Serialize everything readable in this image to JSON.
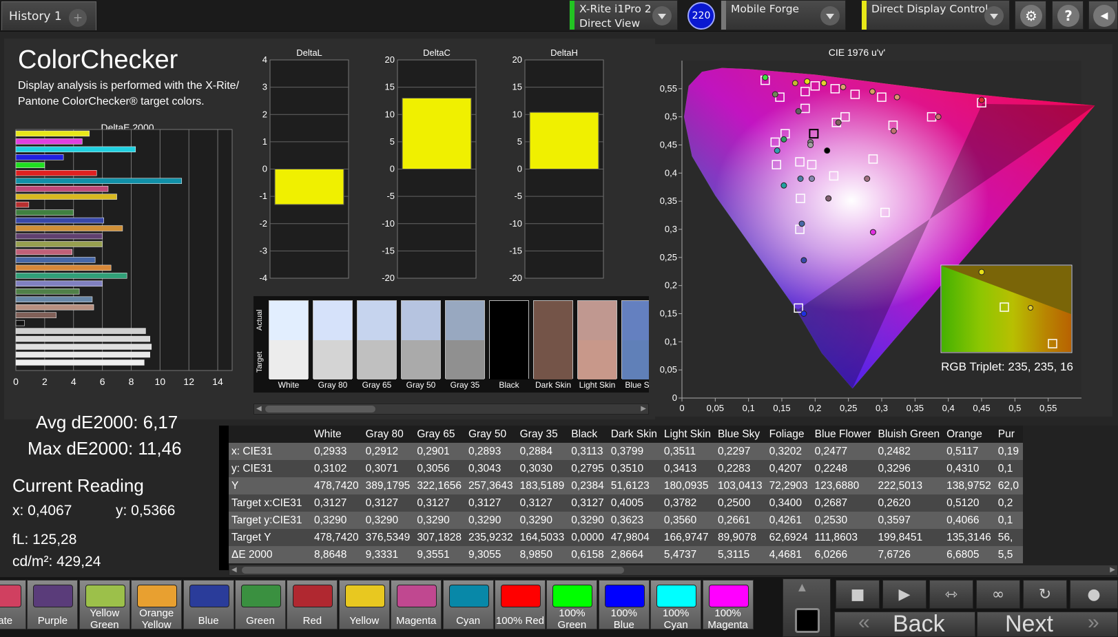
{
  "topbar": {
    "history_tab": "History 1",
    "add_tab": "+",
    "meter_line1": "X-Rite i1Pro 2",
    "meter_line2": "Direct View",
    "badge": "220",
    "generator": "Mobile Forge",
    "display": "Direct Display Control",
    "settings_glyph": "⚙",
    "help_glyph": "?",
    "colors": {
      "meter": "#22c422",
      "generator": "#777777",
      "display": "#e8e818",
      "badge": "#0a18d0"
    }
  },
  "header": {
    "title": "ColorChecker",
    "description": "Display analysis is performed with the X-Rite/ Pantone ColorChecker® target colors."
  },
  "de_chart": {
    "title": "DeltaE 2000",
    "ticks": [
      "0",
      "2",
      "4",
      "6",
      "8",
      "10",
      "12",
      "14"
    ],
    "xlim": [
      0,
      15
    ],
    "bars": [
      {
        "v": 5.1,
        "c": "#e8e818"
      },
      {
        "v": 4.6,
        "c": "#e040e0"
      },
      {
        "v": 8.3,
        "c": "#20d0e0"
      },
      {
        "v": 3.3,
        "c": "#2020e0"
      },
      {
        "v": 2.0,
        "c": "#20e020"
      },
      {
        "v": 5.6,
        "c": "#e02020"
      },
      {
        "v": 11.5,
        "c": "#1090a8"
      },
      {
        "v": 6.4,
        "c": "#c04878"
      },
      {
        "v": 7.0,
        "c": "#d8b820"
      },
      {
        "v": 0.9,
        "c": "#b83030"
      },
      {
        "v": 4.0,
        "c": "#408040"
      },
      {
        "v": 6.1,
        "c": "#3848a8"
      },
      {
        "v": 7.4,
        "c": "#d09038"
      },
      {
        "v": 6.0,
        "c": "#604070"
      },
      {
        "v": 6.0,
        "c": "#98a050"
      },
      {
        "v": 3.9,
        "c": "#c06078"
      },
      {
        "v": 5.5,
        "c": "#4868a8"
      },
      {
        "v": 6.6,
        "c": "#d88838"
      },
      {
        "v": 7.7,
        "c": "#30a078"
      },
      {
        "v": 6.0,
        "c": "#8080c0"
      },
      {
        "v": 4.4,
        "c": "#508048"
      },
      {
        "v": 5.3,
        "c": "#6888a8"
      },
      {
        "v": 5.4,
        "c": "#b89080"
      },
      {
        "v": 2.8,
        "c": "#806058"
      },
      {
        "v": 0.6,
        "c": "#111111"
      },
      {
        "v": 9.0,
        "c": "#d0d0d0"
      },
      {
        "v": 9.3,
        "c": "#d8d8d8"
      },
      {
        "v": 9.4,
        "c": "#e0e0e0"
      },
      {
        "v": 9.3,
        "c": "#e8e8e8"
      },
      {
        "v": 8.9,
        "c": "#f0f0f0"
      }
    ]
  },
  "small_charts": [
    {
      "title": "DeltaL",
      "ticks": [
        "4",
        "3",
        "2",
        "1",
        "0",
        "-1",
        "-2",
        "-3",
        "-4"
      ],
      "ylim": [
        -4,
        4
      ],
      "value": -1.3
    },
    {
      "title": "DeltaC",
      "ticks": [
        "20",
        "15",
        "10",
        "5",
        "0",
        "-5",
        "-10",
        "-15",
        "-20"
      ],
      "ylim": [
        -20,
        20
      ],
      "value": 13.0
    },
    {
      "title": "DeltaH",
      "ticks": [
        "20",
        "15",
        "10",
        "5",
        "0",
        "-5",
        "-10",
        "-15",
        "-20"
      ],
      "ylim": [
        -20,
        20
      ],
      "value": 10.4
    }
  ],
  "swatches": {
    "actual_label": "Actual",
    "target_label": "Target",
    "items": [
      {
        "name": "White",
        "actual": "#e2eefe",
        "target": "#ececec"
      },
      {
        "name": "Gray 80",
        "actual": "#d6e2fa",
        "target": "#d4d4d4"
      },
      {
        "name": "Gray 65",
        "actual": "#c6d4ee",
        "target": "#c0c0c0"
      },
      {
        "name": "Gray 50",
        "actual": "#b6c4e0",
        "target": "#aaaaaa"
      },
      {
        "name": "Gray 35",
        "actual": "#98a8c0",
        "target": "#909090"
      },
      {
        "name": "Black",
        "actual": "#000000",
        "target": "#000000"
      },
      {
        "name": "Dark Skin",
        "actual": "#745448",
        "target": "#745448"
      },
      {
        "name": "Light Skin",
        "actual": "#c09890",
        "target": "#c8988a"
      },
      {
        "name": "Blue Sky",
        "actual": "#6480c0",
        "target": "#6080b8"
      }
    ]
  },
  "cie": {
    "title": "CIE 1976 u'v'",
    "xticks": [
      "0",
      "0,05",
      "0,1",
      "0,15",
      "0,2",
      "0,25",
      "0,3",
      "0,35",
      "0,4",
      "0,45",
      "0,5",
      "0,55"
    ],
    "yticks": [
      "0",
      "0,05",
      "0,1",
      "0,15",
      "0,2",
      "0,25",
      "0,3",
      "0,35",
      "0,4",
      "0,45",
      "0,5",
      "0,55"
    ],
    "xlim": [
      0,
      0.6
    ],
    "ylim": [
      0,
      0.6
    ],
    "targets": [
      [
        0.125,
        0.565
      ],
      [
        0.147,
        0.535
      ],
      [
        0.185,
        0.545
      ],
      [
        0.2,
        0.555
      ],
      [
        0.23,
        0.55
      ],
      [
        0.26,
        0.54
      ],
      [
        0.3,
        0.535
      ],
      [
        0.45,
        0.525
      ],
      [
        0.185,
        0.515
      ],
      [
        0.245,
        0.5
      ],
      [
        0.232,
        0.49
      ],
      [
        0.375,
        0.5
      ],
      [
        0.317,
        0.485
      ],
      [
        0.198,
        0.47
      ],
      [
        0.155,
        0.47
      ],
      [
        0.14,
        0.455
      ],
      [
        0.177,
        0.42
      ],
      [
        0.195,
        0.415
      ],
      [
        0.142,
        0.415
      ],
      [
        0.287,
        0.425
      ],
      [
        0.228,
        0.395
      ],
      [
        0.178,
        0.355
      ],
      [
        0.305,
        0.33
      ],
      [
        0.177,
        0.3
      ],
      [
        0.175,
        0.16
      ]
    ],
    "actual": [
      [
        0.125,
        0.57,
        "#40e040"
      ],
      [
        0.14,
        0.54,
        "#708858"
      ],
      [
        0.17,
        0.56,
        "#c8b830"
      ],
      [
        0.188,
        0.563,
        "#e8e018"
      ],
      [
        0.213,
        0.56,
        "#e8d030"
      ],
      [
        0.242,
        0.553,
        "#e0a070"
      ],
      [
        0.286,
        0.545,
        "#d8a060"
      ],
      [
        0.323,
        0.535,
        "#e09070"
      ],
      [
        0.45,
        0.53,
        "#d83030"
      ],
      [
        0.175,
        0.51,
        "#606060"
      ],
      [
        0.235,
        0.49,
        "#806060"
      ],
      [
        0.385,
        0.5,
        "#d07070"
      ],
      [
        0.318,
        0.475,
        "#c07070"
      ],
      [
        0.218,
        0.44,
        "#000000"
      ],
      [
        0.193,
        0.455,
        "#808080"
      ],
      [
        0.153,
        0.46,
        "#30a060"
      ],
      [
        0.143,
        0.44,
        "#30a0b0"
      ],
      [
        0.193,
        0.45,
        "#a0a0a0"
      ],
      [
        0.178,
        0.39,
        "#5080a8"
      ],
      [
        0.195,
        0.39,
        "#8888b0"
      ],
      [
        0.278,
        0.39,
        "#a07080"
      ],
      [
        0.153,
        0.378,
        "#20a0a0"
      ],
      [
        0.22,
        0.355,
        "#806070"
      ],
      [
        0.18,
        0.31,
        "#4868a8"
      ],
      [
        0.287,
        0.295,
        "#e030e0"
      ],
      [
        0.183,
        0.245,
        "#3848a8"
      ],
      [
        0.183,
        0.15,
        "#2030e0"
      ]
    ],
    "rgb_triplet": "RGB Triplet: 235, 235, 16"
  },
  "stats": {
    "avg": "Avg dE2000: 6,17",
    "max": "Max dE2000: 11,46",
    "current_reading": "Current Reading",
    "x": "x: 0,4067",
    "y": "y: 0,5366",
    "fl": "fL: 125,28",
    "cdm2": "cd/m²: 429,24"
  },
  "table": {
    "columns": [
      "White",
      "Gray 80",
      "Gray 65",
      "Gray 50",
      "Gray 35",
      "Black",
      "Dark Skin",
      "Light Skin",
      "Blue Sky",
      "Foliage",
      "Blue Flower",
      "Bluish Green",
      "Orange",
      "Pur"
    ],
    "rows": [
      {
        "label": "x: CIE31",
        "values": [
          "0,2933",
          "0,2912",
          "0,2901",
          "0,2893",
          "0,2884",
          "0,3113",
          "0,3799",
          "0,3511",
          "0,2297",
          "0,3202",
          "0,2477",
          "0,2482",
          "0,5117",
          "0,19"
        ]
      },
      {
        "label": "y: CIE31",
        "values": [
          "0,3102",
          "0,3071",
          "0,3056",
          "0,3043",
          "0,3030",
          "0,2795",
          "0,3510",
          "0,3413",
          "0,2283",
          "0,4207",
          "0,2248",
          "0,3296",
          "0,4310",
          "0,1"
        ]
      },
      {
        "label": "Y",
        "values": [
          "478,7420",
          "389,1795",
          "322,1656",
          "257,3643",
          "183,5189",
          "0,2384",
          "51,6123",
          "180,0935",
          "103,0413",
          "72,2903",
          "123,6880",
          "222,5013",
          "138,9752",
          "62,0"
        ]
      },
      {
        "label": "Target x:CIE31",
        "values": [
          "0,3127",
          "0,3127",
          "0,3127",
          "0,3127",
          "0,3127",
          "0,3127",
          "0,4005",
          "0,3782",
          "0,2500",
          "0,3400",
          "0,2687",
          "0,2620",
          "0,5120",
          "0,2"
        ]
      },
      {
        "label": "Target y:CIE31",
        "values": [
          "0,3290",
          "0,3290",
          "0,3290",
          "0,3290",
          "0,3290",
          "0,3290",
          "0,3623",
          "0,3560",
          "0,2661",
          "0,4261",
          "0,2530",
          "0,3597",
          "0,4066",
          "0,1"
        ]
      },
      {
        "label": "Target Y",
        "values": [
          "478,7420",
          "376,5349",
          "307,1828",
          "235,9232",
          "164,5033",
          "0,0000",
          "47,9804",
          "166,9747",
          "89,9078",
          "62,6924",
          "111,8603",
          "199,8451",
          "135,3146",
          "56,"
        ]
      },
      {
        "label": "ΔE 2000",
        "values": [
          "8,8648",
          "9,3331",
          "9,3551",
          "9,3055",
          "8,9850",
          "0,6158",
          "2,8664",
          "5,4737",
          "5,3115",
          "4,4681",
          "6,0266",
          "7,6726",
          "6,6805",
          "5,5"
        ]
      }
    ]
  },
  "color_buttons": [
    {
      "l1": "erate",
      "l2": "",
      "c": "#d04060"
    },
    {
      "l1": "Purple",
      "l2": "",
      "c": "#5a3c7a"
    },
    {
      "l1": "Yellow",
      "l2": "Green",
      "c": "#9cc04a"
    },
    {
      "l1": "Orange",
      "l2": "Yellow",
      "c": "#e8a030"
    },
    {
      "l1": "Blue",
      "l2": "",
      "c": "#2a3c9a"
    },
    {
      "l1": "Green",
      "l2": "",
      "c": "#3a9040"
    },
    {
      "l1": "Red",
      "l2": "",
      "c": "#b02830"
    },
    {
      "l1": "Yellow",
      "l2": "",
      "c": "#e8c820"
    },
    {
      "l1": "Magenta",
      "l2": "",
      "c": "#c04890"
    },
    {
      "l1": "Cyan",
      "l2": "",
      "c": "#0888a8"
    },
    {
      "l1": "100% Red",
      "l2": "",
      "c": "#ff0000"
    },
    {
      "l1": "100%",
      "l2": "Green",
      "c": "#00ff00"
    },
    {
      "l1": "100%",
      "l2": "Blue",
      "c": "#0000ff"
    },
    {
      "l1": "100%",
      "l2": "Cyan",
      "c": "#00ffff"
    },
    {
      "l1": "100%",
      "l2": "Magenta",
      "c": "#ff00ff"
    }
  ],
  "nav": {
    "back": "Back",
    "next": "Next",
    "back_glyph": "«",
    "next_glyph": "»"
  }
}
